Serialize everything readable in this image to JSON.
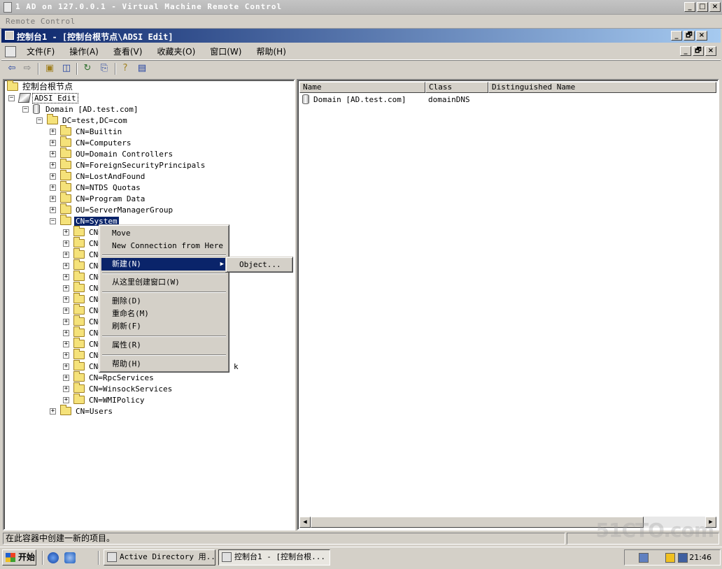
{
  "vm_window": {
    "title": "1 AD on 127.0.0.1 - Virtual Machine Remote Control",
    "subtitle": "Remote Control",
    "buttons": [
      "_",
      "□",
      "×"
    ]
  },
  "mmc_window": {
    "title": "控制台1 - [控制台根节点\\ADSI Edit]",
    "buttons": [
      "_",
      "🗗",
      "×"
    ]
  },
  "menubar": {
    "items": [
      "文件(F)",
      "操作(A)",
      "查看(V)",
      "收藏夹(O)",
      "窗口(W)",
      "帮助(H)"
    ],
    "buttons": [
      "_",
      "🗗",
      "×"
    ]
  },
  "toolbar": {
    "icons": [
      "back-arrow-icon",
      "forward-arrow-icon",
      "up-folder-icon",
      "show-hide-tree-icon",
      "refresh-icon",
      "export-list-icon",
      "help-icon",
      "properties-icon"
    ]
  },
  "tree": {
    "root": "控制台根节点",
    "adsi": "ADSI Edit",
    "domain": "Domain [AD.test.com]",
    "dc": "DC=test,DC=com",
    "children": [
      "CN=Builtin",
      "CN=Computers",
      "OU=Domain Controllers",
      "CN=ForeignSecurityPrincipals",
      "CN=LostAndFound",
      "CN=NTDS Quotas",
      "CN=Program Data",
      "OU=ServerManagerGroup"
    ],
    "selected": "CN=System",
    "system_children_partial": [
      "CN=",
      "CN=",
      "CN=",
      "CN=",
      "CN=",
      "CN=",
      "CN=",
      "CN=",
      "CN=",
      "CN=",
      "CN=",
      "CN=",
      "CN="
    ],
    "trailing_fragment": "k",
    "system_children_visible": [
      "CN=RpcServices",
      "CN=WinsockServices",
      "CN=WMIPolicy"
    ],
    "users": "CN=Users"
  },
  "list": {
    "columns": [
      "Name",
      "Class",
      "Distinguished Name"
    ],
    "rows": [
      {
        "name": "Domain [AD.test.com]",
        "class": "domainDNS",
        "dn": ""
      }
    ]
  },
  "context_menu": {
    "move": "Move",
    "new_connection": "New Connection from Here",
    "new": "新建(N)",
    "new_window": "从这里创建窗口(W)",
    "delete": "删除(D)",
    "rename": "重命名(M)",
    "refresh": "刷新(F)",
    "properties": "属性(R)",
    "help": "帮助(H)",
    "submenu_object": "Object..."
  },
  "statusbar": {
    "text": "在此容器中创建一新的项目。"
  },
  "taskbar": {
    "start": "开始",
    "tasks": [
      "Active Directory 用...",
      "控制台1 - [控制台根..."
    ],
    "clock": "21:46"
  },
  "watermark": "51CTO.com"
}
